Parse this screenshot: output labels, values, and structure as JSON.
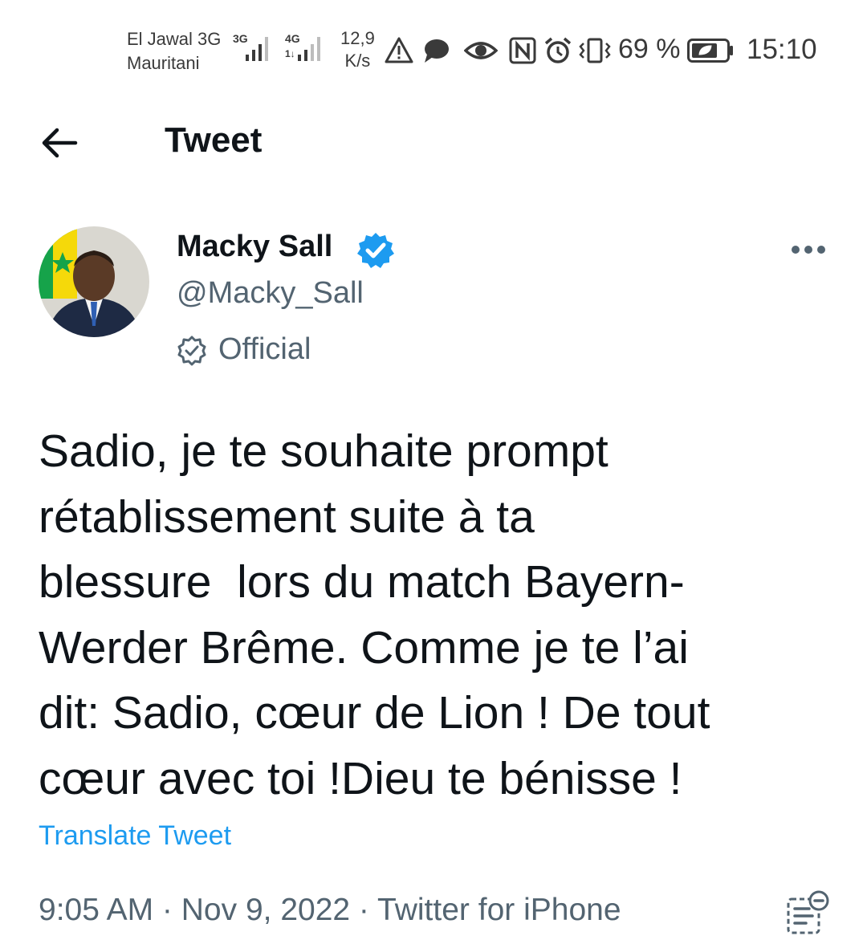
{
  "status_bar": {
    "carrier_line1": "El Jawal 3G",
    "carrier_line2": "Mauritani",
    "sim1_network": "3G",
    "sim2_network": "4G",
    "sim2_arrows": "1↓",
    "speed_value": "12,9",
    "speed_unit": "K/s",
    "icons": [
      "warning-icon",
      "chat-bubble-icon",
      "eye-icon",
      "nfc-icon",
      "alarm-icon",
      "vibrate-icon",
      "battery-icon"
    ],
    "battery_percent": "69 %",
    "time": "15:10"
  },
  "header": {
    "back_icon": "arrow-left-icon",
    "title": "Tweet"
  },
  "tweet": {
    "author": {
      "name": "Macky Sall",
      "handle": "@Macky_Sall",
      "official_label": "Official",
      "verified_color": "#1d9bf0"
    },
    "text": "Sadio, je te souhaite prompt\nrétablissement suite à ta\nblessure  lors du match Bayern-\nWerder Brême. Comme je te l’ai\ndit: Sadio, cœur de Lion ! De tout\ncœur avec toi !Dieu te bénisse !",
    "translate_label": "Translate Tweet",
    "time": "9:05 AM",
    "separator": " · ",
    "date": "Nov 9, 2022",
    "source": "Twitter for iPhone"
  },
  "colors": {
    "text_primary": "#0f1419",
    "text_secondary": "#536471",
    "link": "#1d9bf0"
  }
}
